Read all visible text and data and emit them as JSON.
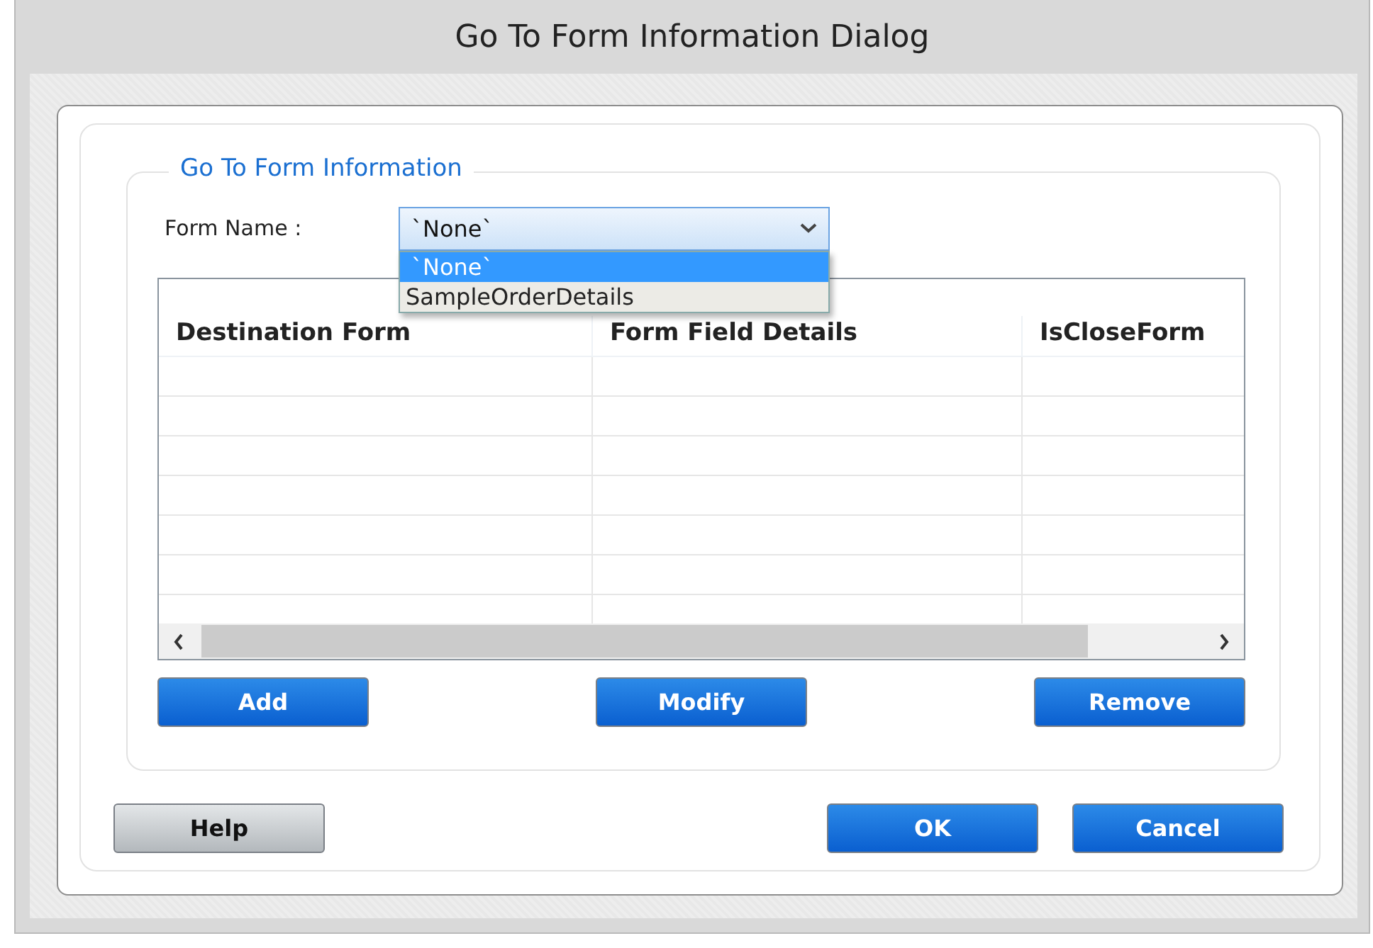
{
  "window": {
    "title": "Go To Form Information Dialog"
  },
  "group": {
    "legend": "Go To Form Information"
  },
  "form_name": {
    "label": "Form Name :",
    "value": "`None`",
    "expanded": true,
    "options": [
      {
        "label": "`None`",
        "selected": true
      },
      {
        "label": "SampleOrderDetails",
        "selected": false
      }
    ]
  },
  "table": {
    "columns": [
      "Destination Form",
      "Form Field Details",
      "IsCloseForm"
    ]
  },
  "table_buttons": [
    "Add",
    "Modify",
    "Remove"
  ],
  "footer_buttons": [
    {
      "label": "Help",
      "kind": "secondary"
    },
    {
      "label": "OK",
      "kind": "primary"
    },
    {
      "label": "Cancel",
      "kind": "primary"
    }
  ]
}
